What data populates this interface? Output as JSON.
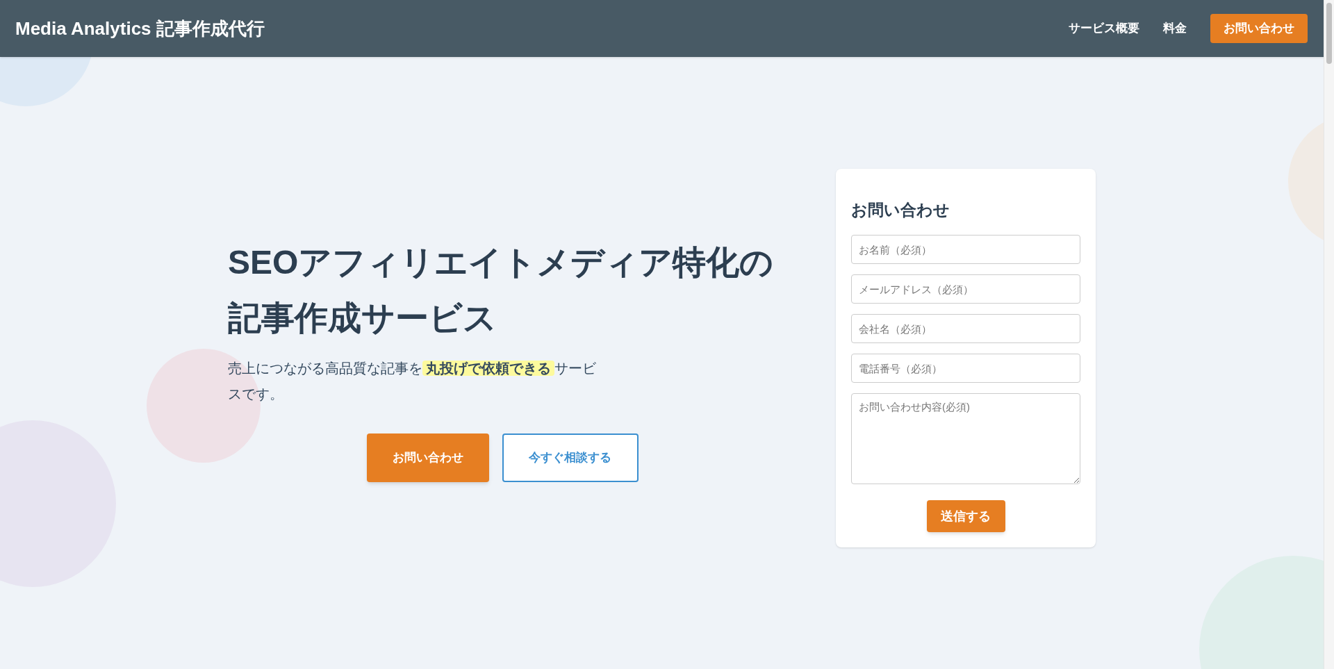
{
  "header": {
    "brand": "Media Analytics 記事作成代行",
    "nav": [
      {
        "label": "サービス概要",
        "kind": "link"
      },
      {
        "label": "料金",
        "kind": "link"
      },
      {
        "label": "お問い合わせ",
        "kind": "button"
      }
    ]
  },
  "hero": {
    "title": "SEOアフィリエイトメディア特化の記事作成サービス",
    "subtitle": {
      "before": "売上につながる高品質な記事を",
      "highlight": "丸投げで依頼できる",
      "after": "サービスです。"
    },
    "buttons": [
      {
        "label": "お問い合わせ",
        "kind": "primary"
      },
      {
        "label": "今すぐ相談する",
        "kind": "outline"
      }
    ]
  },
  "form": {
    "title": "お問い合わせ",
    "fields": [
      {
        "placeholder": "お名前（必須）",
        "kind": "input"
      },
      {
        "placeholder": "メールアドレス（必須）",
        "kind": "input"
      },
      {
        "placeholder": "会社名（必須）",
        "kind": "input"
      },
      {
        "placeholder": "電話番号（必須）",
        "kind": "input"
      },
      {
        "placeholder": "お問い合わせ内容(必須)",
        "kind": "textarea"
      }
    ],
    "submit": "送信する"
  }
}
